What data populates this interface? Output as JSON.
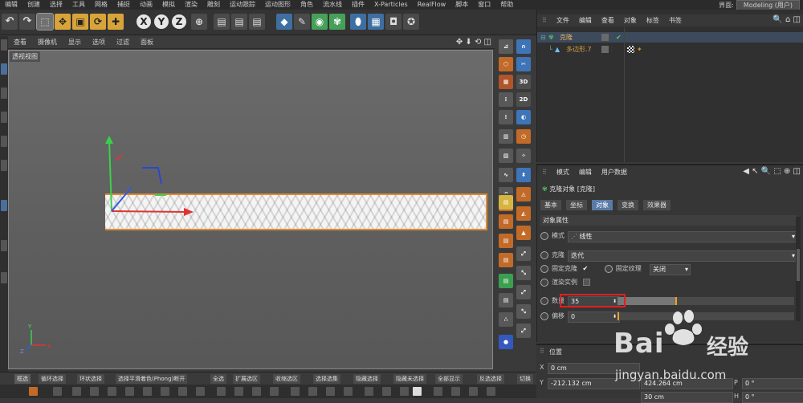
{
  "menubar": {
    "items": [
      "编辑",
      "创建",
      "选择",
      "工具",
      "网格",
      "捕捉",
      "动画",
      "模拟",
      "渲染",
      "雕刻",
      "运动跟踪",
      "运动图形",
      "角色",
      "流水线",
      "插件",
      "X-Particles",
      "RealFlow",
      "脚本",
      "窗口",
      "帮助"
    ],
    "layout_label": "界面:",
    "layout_value": "Modeling (用户)"
  },
  "toolbar": {
    "x_label": "X",
    "y_label": "Y",
    "z_label": "Z"
  },
  "viewport": {
    "menu": [
      "查看",
      "摄像机",
      "显示",
      "选项",
      "过滤",
      "面板"
    ],
    "tools": "✥ ⬇ ⟲ ◫",
    "label": "透视视图",
    "axis_y": "Y",
    "axis_x": "X",
    "axis_z": "Z"
  },
  "right_toolbar": {
    "label_3d": "3D",
    "label_2d": "2D"
  },
  "object_manager": {
    "menu": [
      "文件",
      "编辑",
      "查看",
      "对象",
      "标签",
      "书签"
    ],
    "objects": [
      {
        "name": "克隆",
        "color": "#e0b060"
      },
      {
        "name": "多边形.7",
        "color": "#d2a040"
      }
    ],
    "check": "✔"
  },
  "attribute_manager": {
    "menu": [
      "模式",
      "编辑",
      "用户数据"
    ],
    "object_title": "克隆对象 [克隆]",
    "tabs": [
      "基本",
      "坐标",
      "对象",
      "变换",
      "效果器"
    ],
    "active_tab": "对象",
    "section_title": "对象属性",
    "mode_label": "模式",
    "mode_value": "线性",
    "clone_label": "克隆",
    "clone_value": "迭代",
    "fix_clone_label": "固定克隆",
    "fix_clone_check": "✔",
    "fix_texture_label": "固定纹理",
    "fix_texture_value": "关闭",
    "render_instance_label": "渲染实例",
    "count_label": "数量",
    "count_value": "35",
    "offset_label": "偏移",
    "offset_value": "0",
    "highlight_color": "#e02020"
  },
  "coordinates": {
    "title": "位置",
    "x_label": "X",
    "x_value": "0 cm",
    "y_label": "Y",
    "y_value": "-212.132 cm",
    "y2_value": "424.264 cm",
    "z_value": "",
    "p_label": "P",
    "p_value": "0 °",
    "zbox_value": "30 cm",
    "h_label": "H",
    "h_value": "0 °"
  },
  "mode_bar": {
    "items": [
      "框选",
      "循环选择",
      "环状选择",
      "选择平滑着色(Phong)断开",
      "全选",
      "扩展选区",
      "收缩选区",
      "选择选集",
      "隐藏选择",
      "隐藏未选择",
      "全部显示",
      "反选选择",
      "切换"
    ]
  },
  "watermark": {
    "brand": "Bai",
    "brand_cn": "经验",
    "url": "jingyan.baidu.com"
  }
}
